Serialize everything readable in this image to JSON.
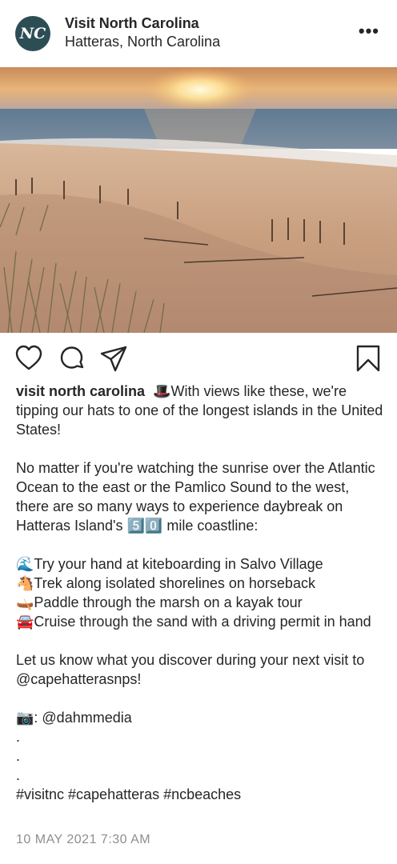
{
  "header": {
    "avatar_text": "NC",
    "account_name": "Visit North Carolina",
    "location": "Hatteras, North Carolina",
    "more_label": "•••"
  },
  "actions": {
    "like_icon": "heart-icon",
    "comment_icon": "comment-icon",
    "share_icon": "send-icon",
    "save_icon": "bookmark-icon"
  },
  "caption": {
    "username": "visit north carolina",
    "line1": "🎩With views like these, we're tipping our hats to one of the longest islands in the United States!",
    "paragraph2": "No matter if you're watching the sunrise over the Atlantic Ocean to the east or the Pamlico Sound to the west, there are so many ways to experience daybreak on Hatteras Island's 5️⃣0️⃣ mile coastline:",
    "list": [
      "🌊Try your hand at kiteboarding in Salvo Village",
      "🐴Trek along isolated shorelines on horseback",
      "🛶Paddle through the marsh on a kayak tour",
      "🚘Cruise through the sand with a driving permit in hand"
    ],
    "paragraph4": "Let us know what you discover during your next visit to @capehatterasnps!",
    "photo_credit": "📷: @dahmmedia",
    "dots": [
      ".",
      ".",
      "."
    ],
    "hashtags": "#visitnc #capehatteras #ncbeaches"
  },
  "timestamp": "10 MAY 2021 7:30 AM",
  "colors": {
    "text": "#262626",
    "muted": "#8e8e8e",
    "avatar_bg": "#2d4d55"
  }
}
